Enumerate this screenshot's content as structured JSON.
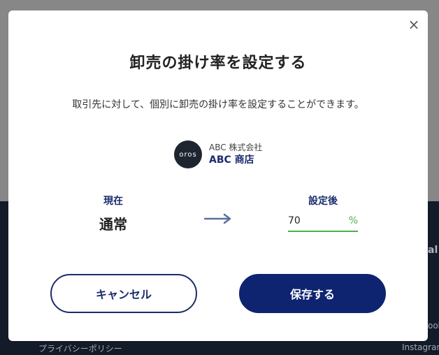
{
  "background": {
    "footer_links": [
      "プライバシーポリシー",
      "Instagram"
    ],
    "footer_fragments": [
      "al",
      "ook"
    ]
  },
  "modal": {
    "close_icon": "×",
    "title": "卸売の掛け率を設定する",
    "description": "取引先に対して、個別に卸売の掛け率を設定することができます。",
    "store": {
      "logo_text": "oros",
      "company": "ABC 株式会社",
      "shop": "ABC 商店"
    },
    "current": {
      "label": "現在",
      "value": "通常"
    },
    "after": {
      "label": "設定後",
      "value": "70",
      "unit": "%"
    },
    "buttons": {
      "cancel": "キャンセル",
      "save": "保存する"
    }
  },
  "colors": {
    "primary": "#0e2470",
    "accent_green": "#4caf50",
    "arrow": "#5b6f9e"
  }
}
